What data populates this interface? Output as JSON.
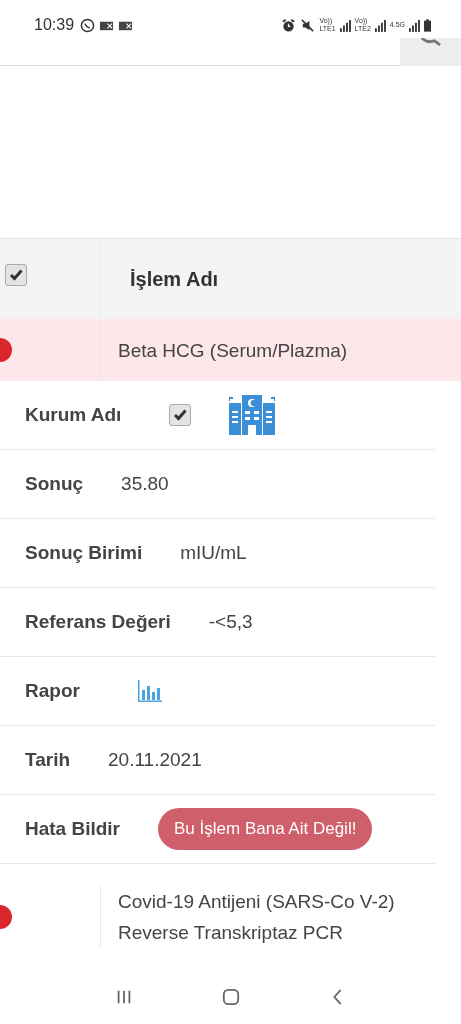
{
  "status_bar": {
    "time": "10:39",
    "networks": [
      {
        "top": "Vo))",
        "bottom": "LTE1"
      },
      {
        "top": "Vo))",
        "bottom": "LTE2"
      }
    ],
    "speed": "4.5G"
  },
  "table": {
    "header": {
      "select_all_checked": true,
      "title": "İşlem Adı"
    },
    "rows": [
      {
        "name": "Beta HCG (Serum/Plazma)",
        "highlighted": true,
        "details": [
          {
            "kind": "institution",
            "label": "Kurum Adı",
            "checked": true
          },
          {
            "kind": "text",
            "label": "Sonuç",
            "value": "35.80"
          },
          {
            "kind": "text",
            "label": "Sonuç Birimi",
            "value": "mIU/mL"
          },
          {
            "kind": "text",
            "label": "Referans Değeri",
            "value": "-<5,3"
          },
          {
            "kind": "report",
            "label": "Rapor"
          },
          {
            "kind": "text",
            "label": "Tarih",
            "value": "20.11.2021"
          },
          {
            "kind": "button",
            "label": "Hata Bildir",
            "button": "Bu İşlem Bana Ait Değil!"
          }
        ]
      },
      {
        "name": "Covid-19 Antijeni (SARS-Co V-2) Reverse Transkriptaz PCR",
        "highlighted": false,
        "details": []
      }
    ]
  }
}
